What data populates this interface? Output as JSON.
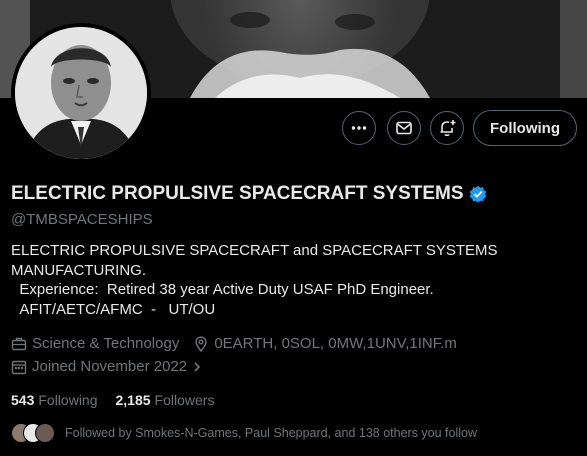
{
  "profile": {
    "name": "ELECTRIC PROPULSIVE SPACECRAFT SYSTEMS",
    "handle": "@TMBSPACESHIPS",
    "bio": "ELECTRIC PROPULSIVE SPACECRAFT and SPACECRAFT SYSTEMS MANUFACTURING.\n  Experience:  Retired 38 year Active Duty USAF PhD Engineer.\n  AFIT/AETC/AFMC  -   UT/OU",
    "category": "Science & Technology",
    "location": "0EARTH, 0SOL, 0MW,1UNV,1INF.m",
    "joined": "Joined November 2022",
    "verified_color": "#1d9bf0"
  },
  "actions": {
    "more_icon": "more-icon",
    "message_icon": "mail-icon",
    "notify_icon": "bell-plus-icon",
    "follow_label": "Following"
  },
  "stats": {
    "following_count": "543",
    "following_label": "Following",
    "followers_count": "2,185",
    "followers_label": "Followers"
  },
  "followed_by": {
    "text": "Followed by Smokes-N-Games, Paul Sheppard, and 138 others you follow"
  }
}
